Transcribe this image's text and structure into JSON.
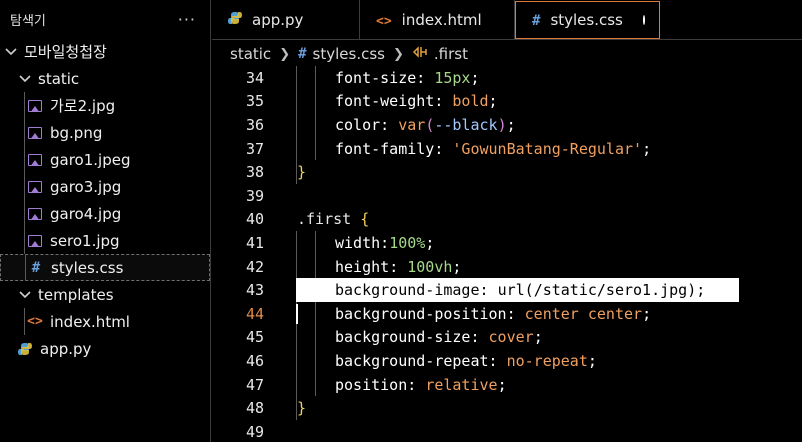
{
  "explorer": {
    "title": "탐색기",
    "more": "···",
    "items": [
      {
        "label": "모바일청첩장",
        "kind": "folder",
        "depth": 0
      },
      {
        "label": "static",
        "kind": "folder",
        "depth": 1
      },
      {
        "label": "가로2.jpg",
        "kind": "image",
        "depth": 2
      },
      {
        "label": "bg.png",
        "kind": "image",
        "depth": 2
      },
      {
        "label": "garo1.jpeg",
        "kind": "image",
        "depth": 2
      },
      {
        "label": "garo3.jpg",
        "kind": "image",
        "depth": 2
      },
      {
        "label": "garo4.jpg",
        "kind": "image",
        "depth": 2
      },
      {
        "label": "sero1.jpg",
        "kind": "image",
        "depth": 2
      },
      {
        "label": "styles.css",
        "kind": "css",
        "depth": 2,
        "selected": true
      },
      {
        "label": "templates",
        "kind": "folder",
        "depth": 1
      },
      {
        "label": "index.html",
        "kind": "html",
        "depth": 2
      },
      {
        "label": "app.py",
        "kind": "python",
        "depth": 1
      }
    ]
  },
  "tabs": [
    {
      "label": "app.py",
      "icon": "python-icon"
    },
    {
      "label": "index.html",
      "icon": "html-icon"
    },
    {
      "label": "styles.css",
      "icon": "css-icon",
      "active": true,
      "unsaved": true
    }
  ],
  "breadcrumb": {
    "folder": "static",
    "file": "styles.css",
    "symbol": ".first"
  },
  "editor": {
    "current_line": 44,
    "highlighted_line": 43,
    "lines": [
      {
        "n": "34",
        "indent": 2,
        "tokens": [
          [
            "prop",
            "font-size"
          ],
          [
            "punc",
            ": "
          ],
          [
            "num",
            "15px"
          ],
          [
            "punc",
            ";"
          ]
        ]
      },
      {
        "n": "35",
        "indent": 2,
        "tokens": [
          [
            "prop",
            "font-weight"
          ],
          [
            "punc",
            ": "
          ],
          [
            "kw",
            "bold"
          ],
          [
            "punc",
            ";"
          ]
        ]
      },
      {
        "n": "36",
        "indent": 2,
        "tokens": [
          [
            "prop",
            "color"
          ],
          [
            "punc",
            ": "
          ],
          [
            "kw",
            "var"
          ],
          [
            "paren",
            "("
          ],
          [
            "var",
            "--black"
          ],
          [
            "paren",
            ")"
          ],
          [
            "punc",
            ";"
          ]
        ]
      },
      {
        "n": "37",
        "indent": 2,
        "tokens": [
          [
            "prop",
            "font-family"
          ],
          [
            "punc",
            ": "
          ],
          [
            "str",
            "'GowunBatang-Regular'"
          ],
          [
            "punc",
            ";"
          ]
        ]
      },
      {
        "n": "38",
        "indent": 1,
        "tokens": [
          [
            "brace",
            "}"
          ]
        ]
      },
      {
        "n": "39",
        "indent": 0,
        "tokens": []
      },
      {
        "n": "40",
        "indent": 0,
        "tokens": [
          [
            "sel",
            ".first "
          ],
          [
            "brace",
            "{"
          ]
        ]
      },
      {
        "n": "41",
        "indent": 2,
        "tokens": [
          [
            "prop",
            "width"
          ],
          [
            "punc",
            ":"
          ],
          [
            "num",
            "100%"
          ],
          [
            "punc",
            ";"
          ]
        ]
      },
      {
        "n": "42",
        "indent": 2,
        "tokens": [
          [
            "prop",
            "height"
          ],
          [
            "punc",
            ": "
          ],
          [
            "num",
            "100vh"
          ],
          [
            "punc",
            ";"
          ]
        ]
      },
      {
        "n": "43",
        "indent": 2,
        "tokens": [
          [
            "prop",
            "background-image"
          ],
          [
            "punc",
            ": "
          ],
          [
            "kw",
            "url"
          ],
          [
            "paren",
            "("
          ],
          [
            "str",
            "/static/sero1.jpg"
          ],
          [
            "paren",
            ")"
          ],
          [
            "punc",
            ";"
          ]
        ]
      },
      {
        "n": "44",
        "indent": 2,
        "tokens": [
          [
            "prop",
            "background-position"
          ],
          [
            "punc",
            ": "
          ],
          [
            "kw",
            "center center"
          ],
          [
            "punc",
            ";"
          ]
        ]
      },
      {
        "n": "45",
        "indent": 2,
        "tokens": [
          [
            "prop",
            "background-size"
          ],
          [
            "punc",
            ": "
          ],
          [
            "kw",
            "cover"
          ],
          [
            "punc",
            ";"
          ]
        ]
      },
      {
        "n": "46",
        "indent": 2,
        "tokens": [
          [
            "prop",
            "background-repeat"
          ],
          [
            "punc",
            ": "
          ],
          [
            "kw",
            "no-repeat"
          ],
          [
            "punc",
            ";"
          ]
        ]
      },
      {
        "n": "47",
        "indent": 2,
        "tokens": [
          [
            "prop",
            "position"
          ],
          [
            "punc",
            ": "
          ],
          [
            "kw",
            "relative"
          ],
          [
            "punc",
            ";"
          ]
        ]
      },
      {
        "n": "48",
        "indent": 1,
        "tokens": [
          [
            "brace",
            "}"
          ]
        ]
      },
      {
        "n": "49",
        "indent": 0,
        "tokens": []
      }
    ]
  }
}
